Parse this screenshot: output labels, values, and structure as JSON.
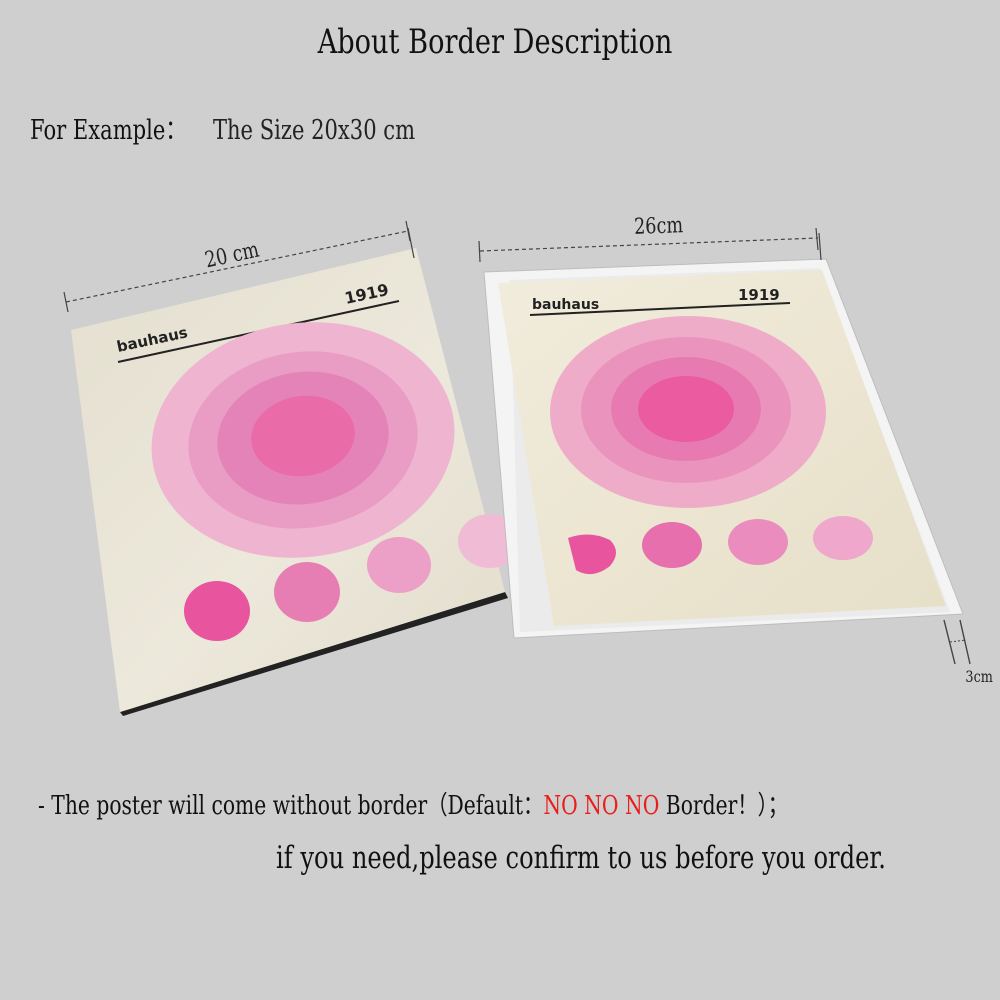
{
  "header": {
    "title": "About Border Description"
  },
  "example": {
    "label": "For Example：",
    "size": "The Size 20x30 cm"
  },
  "measurements": {
    "width_plain": "20 cm",
    "width_bordered": "26cm",
    "border": "3cm"
  },
  "poster": {
    "brand": "bauhaus",
    "year": "1919"
  },
  "notes": {
    "line1_prefix": "- The poster will come without border（Default：",
    "line1_emphasis": "NO NO NO",
    "line1_suffix": " Border！）；",
    "line2": "if you need,please confirm to us before you order."
  },
  "colors": {
    "background": "#cfcfcf",
    "poster_paper": "#ece7d8",
    "border_frame": "#f4f4f4",
    "pink_light": "#f0b8d0",
    "pink_mid": "#e98bb8",
    "pink_deep": "#e85a9e",
    "emphasis_red": "#e8201c"
  }
}
